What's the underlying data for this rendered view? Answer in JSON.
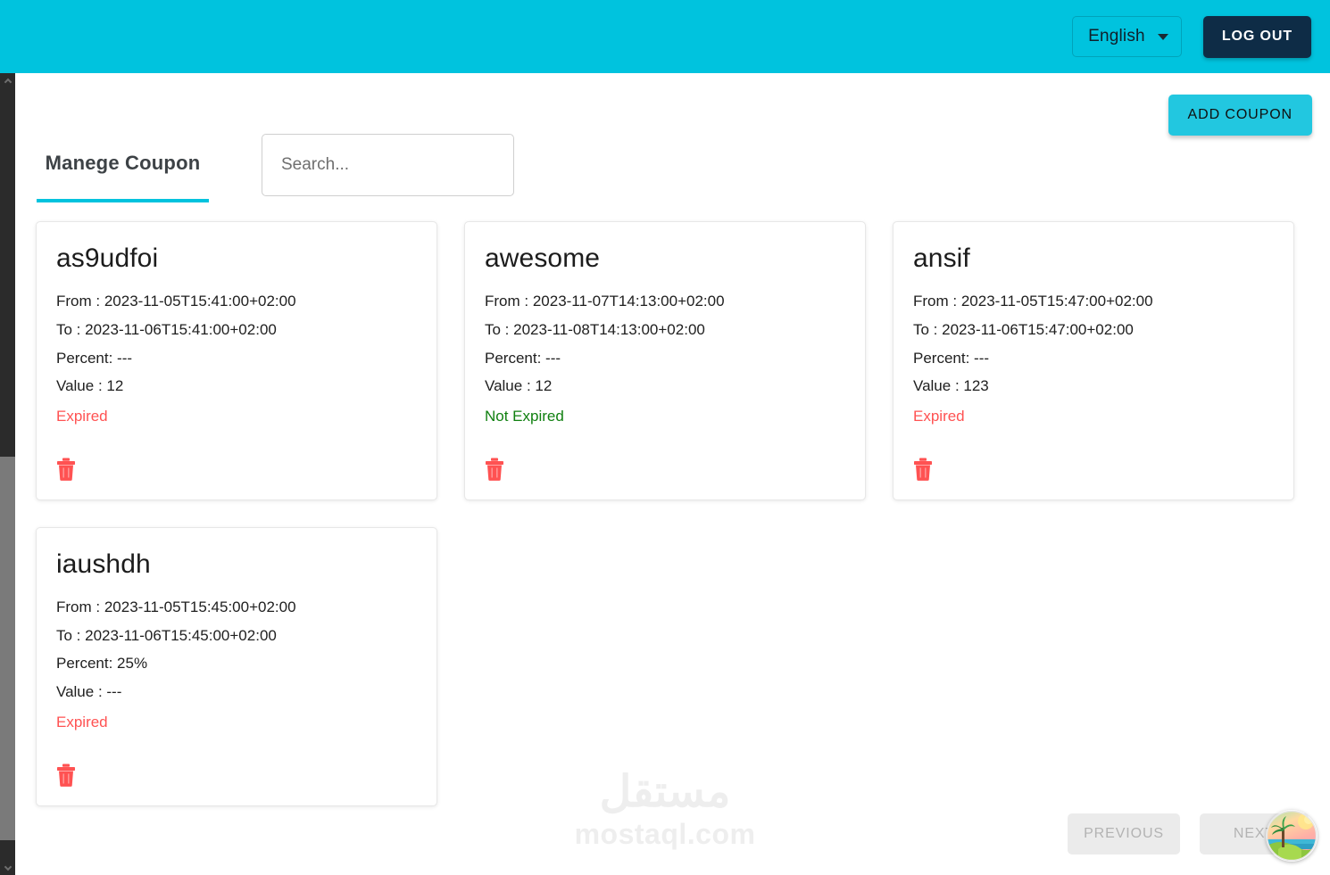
{
  "topbar": {
    "language_label": "English",
    "logout_label": "LOG OUT",
    "background_color": "#00c3de"
  },
  "toolbar": {
    "add_coupon_label": "ADD COUPON",
    "add_coupon_color": "#22c7e0"
  },
  "tabs": [
    {
      "label": "Manege Coupon",
      "active": true,
      "underline_color": "#00c3de"
    }
  ],
  "search": {
    "placeholder": "Search...",
    "value": ""
  },
  "coupons": [
    {
      "title": "as9udfoi",
      "from": "From : 2023-11-05T15:41:00+02:00",
      "to": "To : 2023-11-06T15:41:00+02:00",
      "percent": "Percent: ---",
      "value": "Value : 12",
      "status": "Expired",
      "status_state": "expired",
      "status_color": "#ff5252",
      "delete_icon": "trash-icon"
    },
    {
      "title": "awesome",
      "from": "From : 2023-11-07T14:13:00+02:00",
      "to": "To : 2023-11-08T14:13:00+02:00",
      "percent": "Percent: ---",
      "value": "Value : 12",
      "status": "Not Expired",
      "status_state": "active",
      "status_color": "#108010",
      "delete_icon": "trash-icon"
    },
    {
      "title": "ansif",
      "from": "From : 2023-11-05T15:47:00+02:00",
      "to": "To : 2023-11-06T15:47:00+02:00",
      "percent": "Percent: ---",
      "value": "Value : 123",
      "status": "Expired",
      "status_state": "expired",
      "status_color": "#ff5252",
      "delete_icon": "trash-icon"
    },
    {
      "title": "iaushdh",
      "from": "From : 2023-11-05T15:45:00+02:00",
      "to": "To : 2023-11-06T15:45:00+02:00",
      "percent": "Percent: 25%",
      "value": "Value : ---",
      "status": "Expired",
      "status_state": "expired",
      "status_color": "#ff5252",
      "delete_icon": "trash-icon"
    }
  ],
  "pagination": {
    "previous_label": "PREVIOUS",
    "next_label": "NEXT",
    "previous_disabled": true,
    "next_disabled": true
  },
  "watermark": {
    "arabic": "مستقل",
    "latin": "mostaql.com"
  }
}
